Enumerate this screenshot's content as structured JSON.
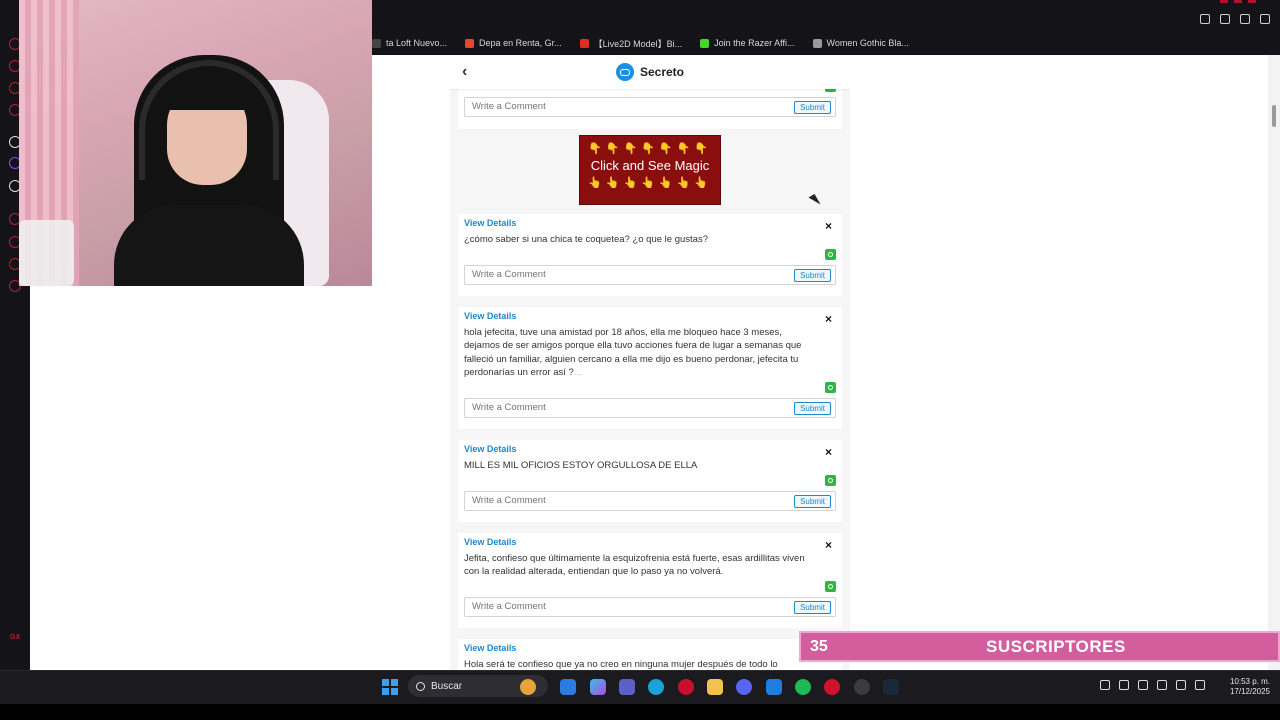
{
  "browser": {
    "bookmarks": [
      {
        "label": "ta Loft Nuevo...",
        "icon": "bookmark-icon",
        "color": "#444444"
      },
      {
        "label": "Depa en Renta, Gr...",
        "icon": "pin-icon",
        "color": "#e24a2f"
      },
      {
        "label": "【Live2D Model】Bi...",
        "icon": "youtube-icon",
        "color": "#e02b2b"
      },
      {
        "label": "Join the Razer Affi...",
        "icon": "razer-icon",
        "color": "#44d62c"
      },
      {
        "label": "Women Gothic Bla...",
        "icon": "store-icon",
        "color": "#9a9a9a"
      }
    ]
  },
  "app": {
    "title": "Secreto",
    "back_icon": "‹",
    "close_symbol": "×",
    "comment_placeholder": "Write a Comment",
    "submit_label": "Submit",
    "view_details_label": "View Details",
    "accent_color": "#1e88c8"
  },
  "ad": {
    "text": "Click and See Magic",
    "hands_down": "👇👇👇👇👇👇👇",
    "hands_up": "👆👆👆👆👆👆👆",
    "background": "#8a0e0e"
  },
  "posts": [
    {
      "text": "¿cómo saber si una chica te coquetea? ¿o que le gustas?"
    },
    {
      "text": "hola jefecita, tuve una amistad por 18 años, ella me bloqueo hace 3 meses, dejamos de ser amigos porque ella tuvo acciones fuera de lugar a semanas que falleció un familiar, alguien cercano a ella me dijo es bueno perdonar, jefecita tu perdonarías un error así ?",
      "ellipsis": "..."
    },
    {
      "text": "MILL ES MIL OFICIOS ESTOY ORGULLOSA DE ELLA"
    },
    {
      "text": "Jefita, confieso que últimamente la esquizofrenia está fuerte, esas ardillitas viven con la realidad alterada, entiendan que lo paso ya no volverá."
    },
    {
      "text": "Hola será te confieso que ya no creo en ninguna mujer después de todo lo"
    }
  ],
  "overlay": {
    "subscriber_count": "35",
    "subscriber_label": "SUSCRIPTORES",
    "banner_color": "#d35e9e"
  },
  "taskbar": {
    "search_label": "Buscar",
    "time": "10:53 p. m.",
    "date": "17/12/2025"
  },
  "sidebar": {
    "bottom_label": "GX"
  }
}
